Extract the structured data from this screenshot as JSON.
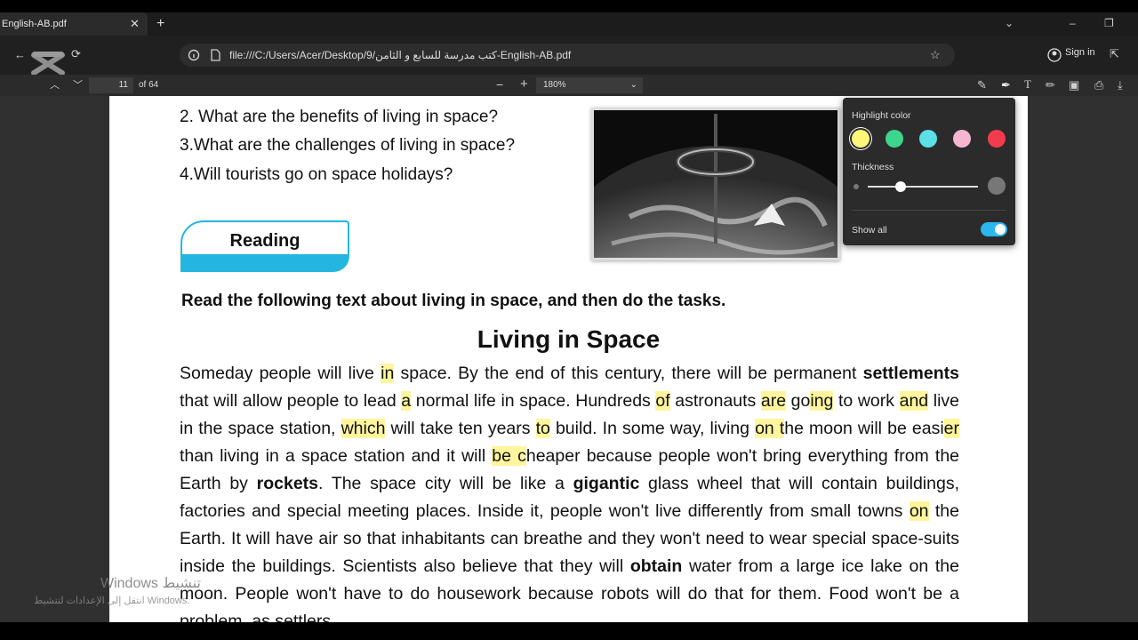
{
  "tab": {
    "title": "English-AB.pdf",
    "close": "✕",
    "new_tab": "+"
  },
  "window": {
    "collapse": "⌄",
    "minimize": "–",
    "restore": "❐"
  },
  "address": {
    "url": "file:///C:/Users/Acer/Desktop/9/كتب مدرسة للسابع و الثامن-English-AB.pdf",
    "sign_in": "Sign in"
  },
  "pdf_toolbar": {
    "page": "11",
    "total": "of 64",
    "zoom": "180%",
    "zoom_out": "−",
    "zoom_in": "+"
  },
  "page": {
    "questions": [
      "2. What are the benefits of living in space?",
      "3.What are the challenges of living in space?",
      "4.Will tourists go on space holidays?"
    ],
    "reading_label": "Reading",
    "instruction": "Read the following text about living in space, and then do the tasks.",
    "title": "Living in Space"
  },
  "highlight_popup": {
    "label": "Highlight color",
    "colors": [
      "#fff67a",
      "#3dd68c",
      "#5ae0e6",
      "#f6b6d2",
      "#f23c4e"
    ],
    "thickness_label": "Thickness",
    "thickness_level": 0.3,
    "show_all_label": "Show all",
    "show_all_on": true
  },
  "watermark": {
    "line1": "Windows تنشيط",
    "line2": "انتقل إلى الإعدادات لتنشيط Windows."
  }
}
